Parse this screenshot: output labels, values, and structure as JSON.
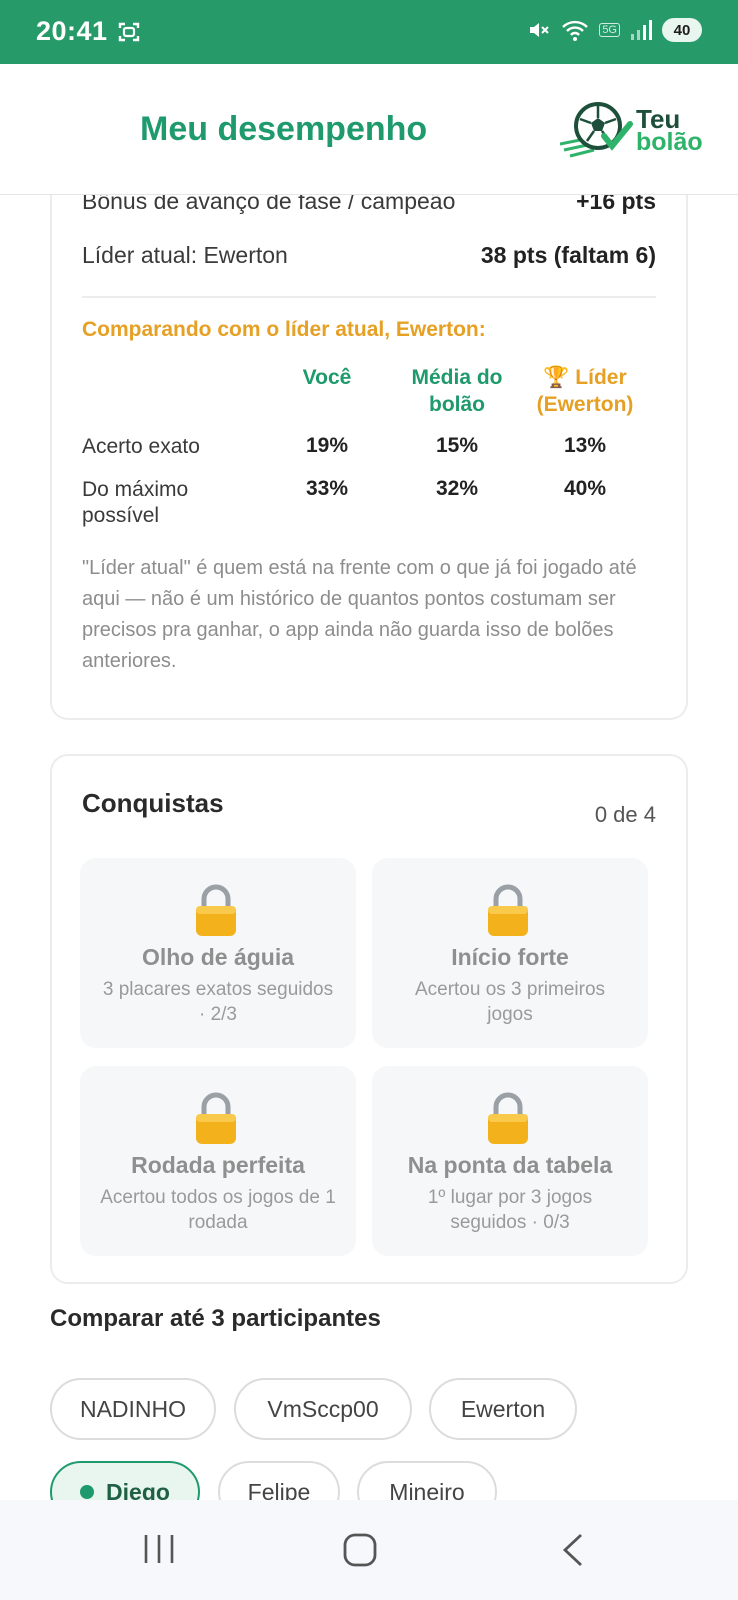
{
  "status_bar": {
    "time": "20:41",
    "network_badge": "5G",
    "battery": "40"
  },
  "header": {
    "title": "Meu desempenho",
    "logo_line1": "Teu",
    "logo_line2": "bolão"
  },
  "summary": {
    "rows": [
      {
        "label": "Bônus de avanço de fase / campeão",
        "value": "+16 pts"
      },
      {
        "label": "Líder atual: Ewerton",
        "value": "38 pts (faltam 6)"
      }
    ],
    "comparison_title": "Comparando com o líder atual, Ewerton:",
    "columns": {
      "you": "Você",
      "avg_l1": "Média do",
      "avg_l2": "bolão",
      "leader_l1": "🏆 Líder",
      "leader_l2": "(Ewerton)"
    },
    "metrics": [
      {
        "label_l1": "Acerto exato",
        "label_l2": "",
        "you": "19%",
        "avg": "15%",
        "leader": "13%"
      },
      {
        "label_l1": "Do máximo",
        "label_l2": "possível",
        "you": "33%",
        "avg": "32%",
        "leader": "40%"
      }
    ],
    "note": "\"Líder atual\" é quem está na frente com o que já foi jogado até aqui — não é um histórico de quantos pontos costumam ser precisos pra ganhar, o app ainda não guarda isso de bolões anteriores."
  },
  "achievements": {
    "title": "Conquistas",
    "count": "0 de 4",
    "items": [
      {
        "title": "Olho de águia",
        "desc": "3 placares exatos seguidos · 2/3"
      },
      {
        "title": "Início forte",
        "desc": "Acertou os 3 primeiros jogos"
      },
      {
        "title": "Rodada perfeita",
        "desc": "Acertou todos os jogos de 1 rodada"
      },
      {
        "title": "Na ponta da tabela",
        "desc": "1º lugar por 3 jogos seguidos · 0/3"
      }
    ]
  },
  "compare": {
    "title": "Comparar até 3 participantes",
    "chips": [
      "NADINHO",
      "VmSccp00",
      "Ewerton",
      "Diego",
      "Felipe",
      "Mineiro"
    ],
    "selected": "Diego"
  },
  "colors": {
    "brand_green": "#279a6a",
    "title_green": "#1f9a6c",
    "accent_orange": "#e6a024"
  }
}
